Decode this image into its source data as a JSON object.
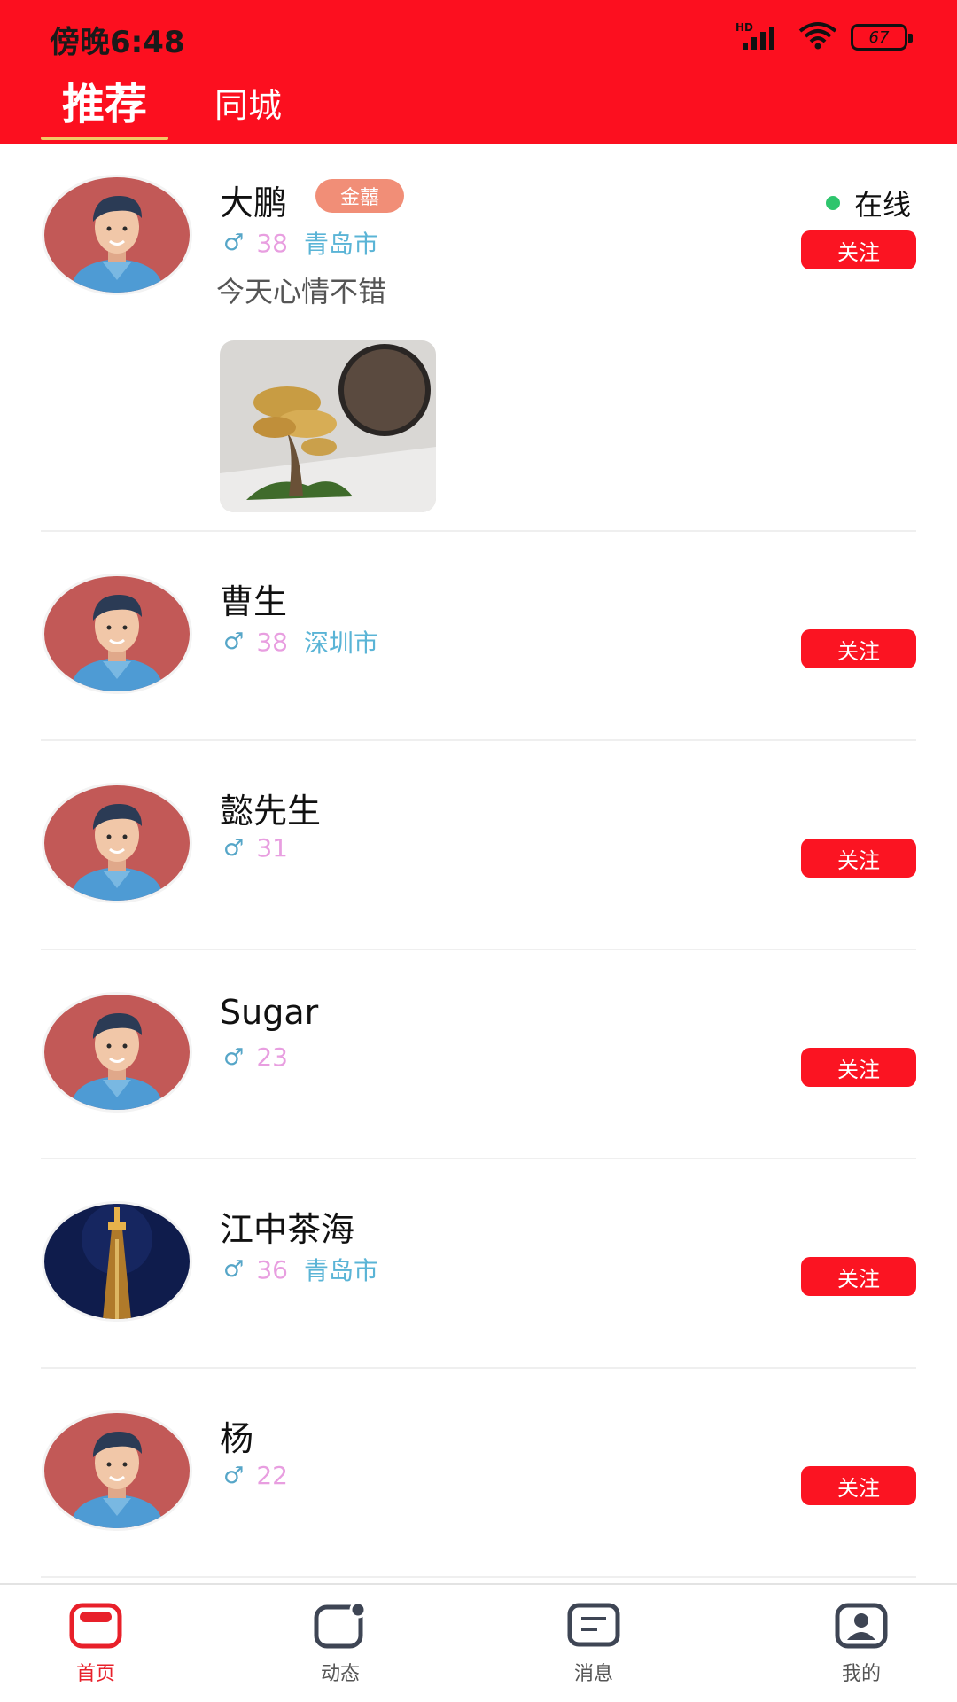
{
  "status_bar": {
    "time": "傍晚6:48",
    "network_label": "HD",
    "battery_level": "67"
  },
  "tabs": [
    {
      "label": "推荐",
      "active": true
    },
    {
      "label": "同城",
      "active": false
    }
  ],
  "users": [
    {
      "name": "大鹏",
      "badge": "金囍",
      "gender_symbol": "♂",
      "age": "38",
      "city": "青岛市",
      "online_label": "在线",
      "status_text": "今天心情不错",
      "follow_label": "关注"
    },
    {
      "name": "曹生",
      "gender_symbol": "♂",
      "age": "38",
      "city": "深圳市",
      "follow_label": "关注"
    },
    {
      "name": "懿先生",
      "gender_symbol": "♂",
      "age": "31",
      "follow_label": "关注"
    },
    {
      "name": "Sugar",
      "gender_symbol": "♂",
      "age": "23",
      "follow_label": "关注"
    },
    {
      "name": "江中茶海",
      "gender_symbol": "♂",
      "age": "36",
      "city": "青岛市",
      "follow_label": "关注"
    },
    {
      "name": "杨",
      "gender_symbol": "♂",
      "age": "22",
      "follow_label": "关注"
    }
  ],
  "bottom_nav": [
    {
      "label": "首页",
      "icon": "home-icon",
      "active": true
    },
    {
      "label": "动态",
      "icon": "moments-icon",
      "active": false
    },
    {
      "label": "消息",
      "icon": "message-icon",
      "active": false
    },
    {
      "label": "我的",
      "icon": "profile-icon",
      "active": false
    }
  ],
  "colors": {
    "brand_red": "#fc0f1f",
    "tab_indicator": "#f3c766",
    "online_green": "#2ec56d",
    "age_pink": "#e89ee0",
    "city_blue": "#5ab4d6",
    "vip_badge": "#f18e77"
  }
}
